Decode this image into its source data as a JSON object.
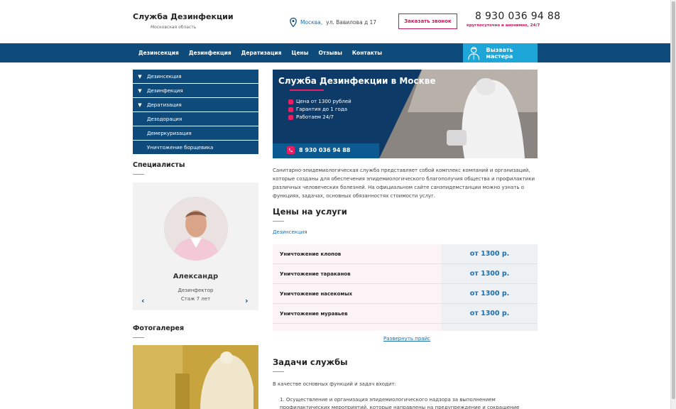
{
  "header": {
    "logo_title": "Служба Дезинфекции",
    "logo_subtitle": "Московская область",
    "city": "Москва,",
    "street": "ул. Вавилова д 17",
    "callback_label": "Заказать звонок",
    "phone": "8 930 036 94 88",
    "phone_note": "круглосуточно и анонимно, 24/7"
  },
  "nav": {
    "items": [
      "Дезинсекция",
      "Дезинфекция",
      "Дератизация",
      "Цены",
      "Отзывы",
      "Контакты"
    ],
    "master_button": "Вызвать мастера"
  },
  "sidebar": {
    "menu": [
      {
        "label": "Дезинсекция",
        "arrow": "▼"
      },
      {
        "label": "Дезинфекция",
        "arrow": "▼"
      },
      {
        "label": "Дератизация",
        "arrow": "▼"
      },
      {
        "label": "Дезодорация"
      },
      {
        "label": "Демеркуризация"
      },
      {
        "label": "Уничтожение борщевика"
      }
    ],
    "specialists_title": "Специалисты",
    "specialist": {
      "name": "Александр",
      "role": "Дезинфектор",
      "experience": "Стаж 7 лет",
      "prev": "‹",
      "next": "›"
    },
    "gallery_title": "Фотогалерея"
  },
  "banner": {
    "title": "Служба Дезинфекции в Москве",
    "points": [
      "Цена от 1300 рублей",
      "Гарантия до 1 года",
      "Работаем 24/7"
    ],
    "phone": "8 930 036 94 88"
  },
  "main": {
    "intro": "Санитарно-эпидемиологическая служба представляет собой комплекс компаний и организаций, которые созданы для обеспечения эпидемиологического благополучия общества и профилактики различных человеческих болезней. На официальном сайте санэпидемстанции можно узнать о функциях, задачах, основных обязанностях стоимости услуг.",
    "prices_title": "Цены на услуги",
    "category_link": "Дезинсекция",
    "prices": [
      {
        "name": "Уничтожение клопов",
        "price": "от 1300 р."
      },
      {
        "name": "Уничтожение тараканов",
        "price": "от 1300 р."
      },
      {
        "name": "Уничтожение насекомых",
        "price": "от 1300 р."
      },
      {
        "name": "Уничтожение муравьев",
        "price": "от 1300 р."
      }
    ],
    "expand_link": "Развернуть прайс",
    "tasks_title": "Задачи службы",
    "tasks_intro": "В качестве основных функций и задач входит:",
    "task_1": "Осуществление и организация эпидемиологического надзора за выполнением профилактических мероприятий, которые направлены на предупреждение и сокращение заболеваемости"
  },
  "colors": {
    "nav": "#0e4a7a",
    "accent": "#c2185b",
    "cta": "#1fa6d9",
    "link": "#1a6fb0"
  }
}
